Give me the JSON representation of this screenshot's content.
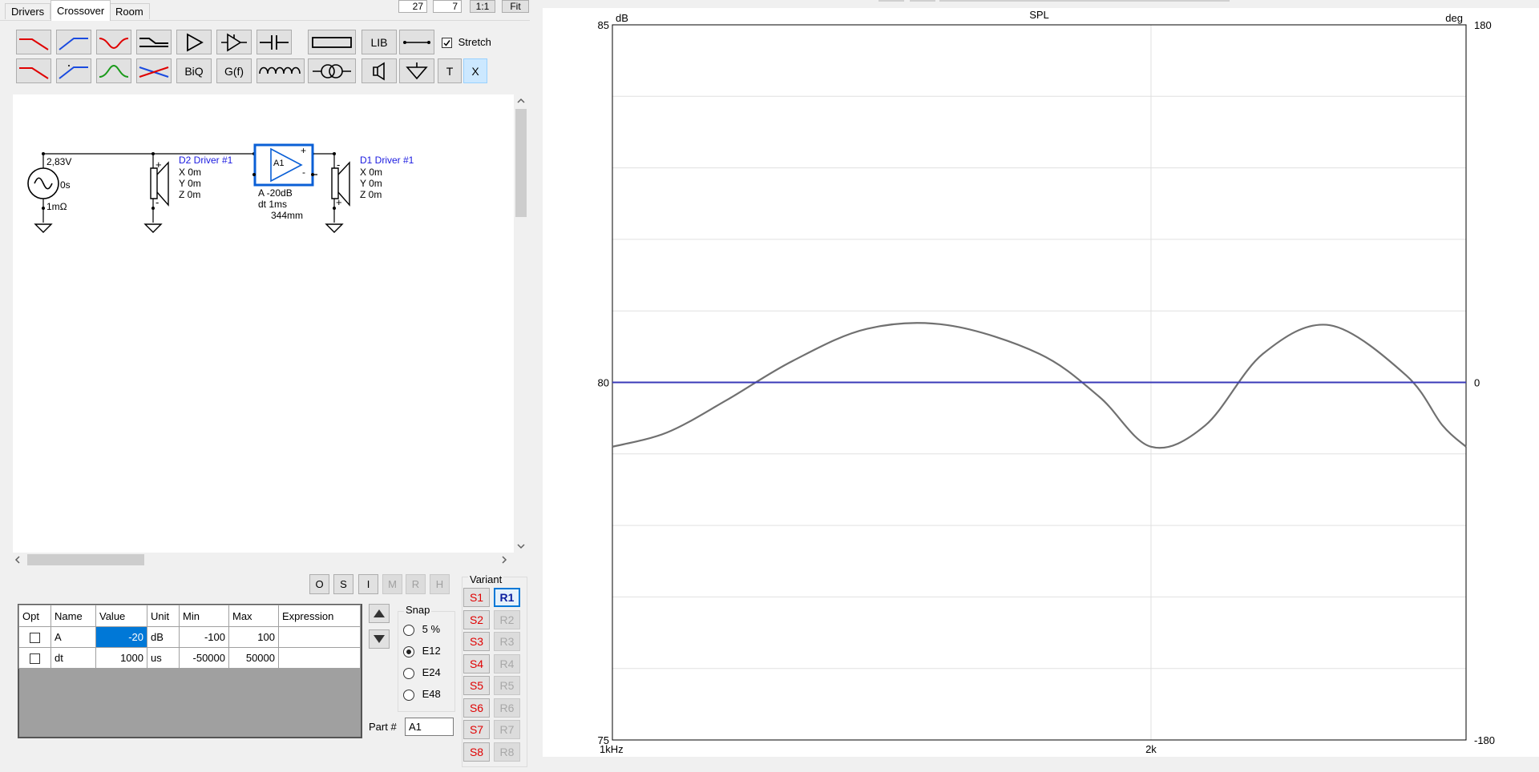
{
  "tabs": [
    {
      "label": "Drivers"
    },
    {
      "label": "Crossover"
    },
    {
      "label": "Room"
    }
  ],
  "topbar": {
    "field1": "27",
    "field2": "7",
    "btn_11": "1:1",
    "btn_fit": "Fit"
  },
  "toolbar": {
    "lib_label": "LIB",
    "stretch_label": "Stretch",
    "stretch_checked": true,
    "biq_label": "BiQ",
    "gf_label": "G(f)",
    "t_label": "T",
    "x_label": "X"
  },
  "schematic": {
    "source_voltage": "2,83V",
    "source_delay": "0s",
    "source_resistance": "1mΩ",
    "d2_label": "D2 Driver #1",
    "d2_x": "X 0m",
    "d2_y": "Y 0m",
    "d2_z": "Z 0m",
    "amp_label": "A1",
    "amp_gain": "A  -20dB",
    "amp_dt": "dt 1ms",
    "amp_dist": "344mm",
    "d1_label": "D1 Driver #1",
    "d1_x": "X 0m",
    "d1_y": "Y 0m",
    "d1_z": "Z 0m"
  },
  "small_buttons": [
    "O",
    "S",
    "I",
    "M",
    "R",
    "H"
  ],
  "grid": {
    "headers": [
      "Opt",
      "Name",
      "Value",
      "Unit",
      "Min",
      "Max",
      "Expression"
    ],
    "rows": [
      {
        "name": "A",
        "value": "-20",
        "unit": "dB",
        "min": "-100",
        "max": "100",
        "expression": ""
      },
      {
        "name": "dt",
        "value": "1000",
        "unit": "us",
        "min": "-50000",
        "max": "50000",
        "expression": ""
      }
    ]
  },
  "snap": {
    "title": "Snap",
    "options": [
      "5 %",
      "E12",
      "E24",
      "E48"
    ],
    "selected": "E12"
  },
  "part": {
    "label": "Part #",
    "value": "A1"
  },
  "variant": {
    "title": "Variant",
    "s": [
      "S1",
      "S2",
      "S3",
      "S4",
      "S5",
      "S6",
      "S7",
      "S8"
    ],
    "r": [
      "R1",
      "R2",
      "R3",
      "R4",
      "R5",
      "R6",
      "R7",
      "R8"
    ],
    "active_r": "R1"
  },
  "chart_data": {
    "type": "line",
    "title": "SPL",
    "ylabel_left": "dB",
    "ylabel_right": "deg",
    "ylim_left": [
      75,
      85
    ],
    "ylim_right": [
      -180,
      180
    ],
    "y_ticks_left": [
      "85",
      "80",
      "75"
    ],
    "y_ticks_right": [
      "180",
      "0",
      "-180"
    ],
    "x_ticks": [
      "1kHz",
      "2k"
    ],
    "xlim": [
      1000,
      3000
    ],
    "x_scale": "log",
    "grid": true,
    "series": [
      {
        "color": "#707070",
        "axis": "left",
        "x": [
          1000,
          1073,
          1158,
          1261,
          1388,
          1540,
          1732,
          1871,
          2000,
          2145,
          2310,
          2517,
          2777,
          2910,
          3000
        ],
        "y": [
          79.1,
          79.3,
          79.75,
          80.3,
          80.75,
          80.8,
          80.4,
          79.8,
          79.1,
          79.4,
          80.4,
          80.8,
          80.1,
          79.4,
          79.1
        ]
      },
      {
        "color": "#3a3ab8",
        "axis": "left",
        "x": [
          1000,
          3000
        ],
        "y": [
          80,
          80
        ]
      }
    ]
  }
}
